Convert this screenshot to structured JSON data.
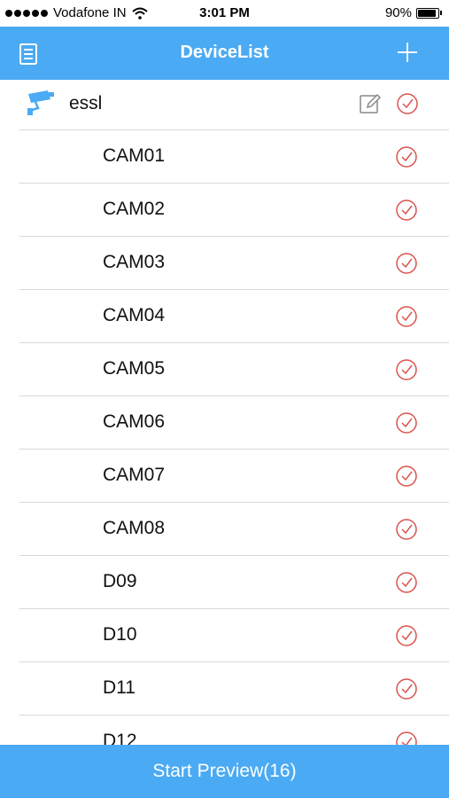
{
  "status_bar": {
    "carrier": "Vodafone IN",
    "time": "3:01 PM",
    "battery_text": "90%",
    "battery_level": 0.9
  },
  "nav": {
    "title": "DeviceList",
    "menu_icon": "list-icon",
    "add_icon": "plus-icon"
  },
  "device_group": {
    "name": "essl",
    "icon": "camera-icon",
    "edit_icon": "edit-icon",
    "check_icon": "check-circle-icon"
  },
  "channels": [
    {
      "label": "CAM01"
    },
    {
      "label": "CAM02"
    },
    {
      "label": "CAM03"
    },
    {
      "label": "CAM04"
    },
    {
      "label": "CAM05"
    },
    {
      "label": "CAM06"
    },
    {
      "label": "CAM07"
    },
    {
      "label": "CAM08"
    },
    {
      "label": "D09"
    },
    {
      "label": "D10"
    },
    {
      "label": "D11"
    },
    {
      "label": "D12"
    }
  ],
  "footer": {
    "start_preview_label": "Start Preview(16)"
  },
  "colors": {
    "accent": "#4aaaf3",
    "check": "#d9534f"
  }
}
